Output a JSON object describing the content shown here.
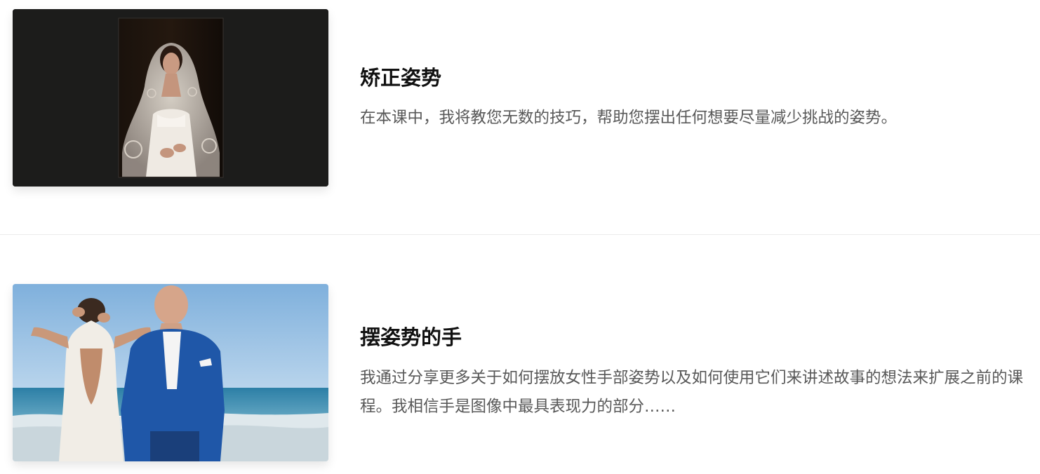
{
  "lessons": [
    {
      "thumbnail": "bride-in-lace-veil-portrait",
      "title": "矫正姿势",
      "description": "在本课中，我将教您无数的技巧，帮助您摆出任何想要尽量减少挑战的姿势。"
    },
    {
      "thumbnail": "couple-on-beach-photo",
      "title": "摆姿势的手",
      "description": "我通过分享更多关于如何摆放女性手部姿势以及如何使用它们来讲述故事的想法来扩展之前的课程。我相信手是图像中最具表现力的部分……"
    }
  ],
  "colors": {
    "title": "#111111",
    "description": "#585858",
    "divider": "#ececec",
    "dark_thumb_bg": "#1c1c1b"
  }
}
